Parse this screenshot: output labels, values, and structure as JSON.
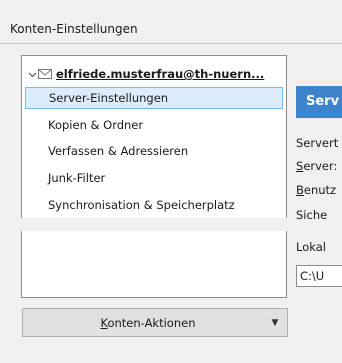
{
  "window": {
    "title": "Konten-Einstellungen"
  },
  "tree": {
    "account": "elfriede.musterfrau@th-nuern...",
    "items": [
      {
        "label": "Server-Einstellungen",
        "selected": true
      },
      {
        "label": "Kopien & Ordner"
      },
      {
        "label": "Verfassen & Adressieren"
      },
      {
        "label": "Junk-Filter"
      },
      {
        "label": "Synchronisation & Speicherplatz"
      }
    ]
  },
  "actions": {
    "button_hotkey": "K",
    "button_rest": "onten-Aktionen"
  },
  "panel": {
    "banner": "Serv",
    "server_type": "Servert",
    "server_name_hotkey": "S",
    "server_name_rest": "erver:",
    "username_hotkey": "B",
    "username_rest": "enutz",
    "security": "Siche",
    "local": "Lokal",
    "path": "C:\\U"
  },
  "colors": {
    "accent": "#3d84cc",
    "selection": "#dcecfc",
    "selection_border": "#7db8ee"
  }
}
